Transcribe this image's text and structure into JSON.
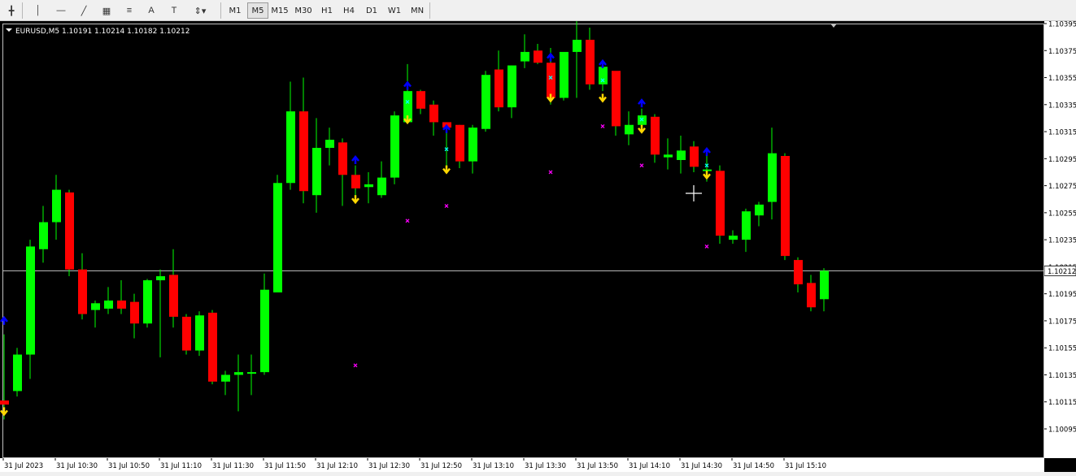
{
  "toolbar": {
    "tools": [
      {
        "name": "crosshair-icon",
        "glyph": "╋"
      },
      {
        "name": "vertical-line-icon",
        "glyph": "│"
      },
      {
        "name": "horizontal-line-icon",
        "glyph": "—"
      },
      {
        "name": "trendline-icon",
        "glyph": "╱"
      },
      {
        "name": "gann-icon",
        "glyph": "▦"
      },
      {
        "name": "fibonacci-icon",
        "glyph": "≡"
      },
      {
        "name": "text-icon",
        "glyph": "A"
      },
      {
        "name": "text-label-icon",
        "glyph": "T"
      },
      {
        "name": "arrows-menu-icon",
        "glyph": "⇕▾"
      }
    ],
    "timeframes": [
      "M1",
      "M5",
      "M15",
      "M30",
      "H1",
      "H4",
      "D1",
      "W1",
      "MN"
    ],
    "active_timeframe": "M5"
  },
  "chart": {
    "header": "EURUSD,M5  1.10191 1.10214 1.10182 1.10212",
    "current_price": "1.10212",
    "colors": {
      "bull": "#00ff00",
      "bear": "#ff0000",
      "wick": "#00ff00",
      "background": "#000000",
      "up_arrow": "#0000ff",
      "down_arrow": "#ffd700",
      "cross_cyan": "#00ffff",
      "cross_magenta": "#ff00ff"
    }
  },
  "chart_data": {
    "type": "candlestick",
    "symbol": "EURUSD",
    "timeframe": "M5",
    "y_ticks": [
      "1.10395",
      "1.10375",
      "1.10355",
      "1.10335",
      "1.10315",
      "1.10295",
      "1.10275",
      "1.10255",
      "1.10235",
      "1.10215",
      "1.10195",
      "1.10175",
      "1.10155",
      "1.10135",
      "1.10115",
      "1.10095"
    ],
    "x_ticks": [
      "31 Jul 2023",
      "31 Jul 10:30",
      "31 Jul 10:50",
      "31 Jul 11:10",
      "31 Jul 11:30",
      "31 Jul 11:50",
      "31 Jul 12:10",
      "31 Jul 12:30",
      "31 Jul 12:50",
      "31 Jul 13:10",
      "31 Jul 13:30",
      "31 Jul 13:50",
      "31 Jul 14:10",
      "31 Jul 14:30",
      "31 Jul 14:50",
      "31 Jul 15:10"
    ],
    "ylim": [
      1.10085,
      1.10415
    ],
    "candles": [
      {
        "o": 1.10116,
        "h": 1.10165,
        "l": 1.10102,
        "c": 1.10113
      },
      {
        "o": 1.10123,
        "h": 1.10155,
        "l": 1.10119,
        "c": 1.1015
      },
      {
        "o": 1.1015,
        "h": 1.10235,
        "l": 1.10132,
        "c": 1.1023
      },
      {
        "o": 1.10228,
        "h": 1.1026,
        "l": 1.10218,
        "c": 1.10248
      },
      {
        "o": 1.10248,
        "h": 1.10283,
        "l": 1.10235,
        "c": 1.10272
      },
      {
        "o": 1.1027,
        "h": 1.10272,
        "l": 1.10208,
        "c": 1.10213
      },
      {
        "o": 1.10213,
        "h": 1.10225,
        "l": 1.10176,
        "c": 1.1018
      },
      {
        "o": 1.10183,
        "h": 1.1019,
        "l": 1.1017,
        "c": 1.10188
      },
      {
        "o": 1.10184,
        "h": 1.102,
        "l": 1.1018,
        "c": 1.1019
      },
      {
        "o": 1.1019,
        "h": 1.10205,
        "l": 1.1018,
        "c": 1.10184
      },
      {
        "o": 1.10189,
        "h": 1.10195,
        "l": 1.10162,
        "c": 1.10173
      },
      {
        "o": 1.10173,
        "h": 1.10206,
        "l": 1.1017,
        "c": 1.10205
      },
      {
        "o": 1.10205,
        "h": 1.10213,
        "l": 1.10148,
        "c": 1.10208
      },
      {
        "o": 1.10209,
        "h": 1.10228,
        "l": 1.1017,
        "c": 1.10178
      },
      {
        "o": 1.10178,
        "h": 1.1018,
        "l": 1.1015,
        "c": 1.10153
      },
      {
        "o": 1.10153,
        "h": 1.10182,
        "l": 1.10149,
        "c": 1.10179
      },
      {
        "o": 1.10181,
        "h": 1.10183,
        "l": 1.10128,
        "c": 1.1013
      },
      {
        "o": 1.1013,
        "h": 1.10138,
        "l": 1.1012,
        "c": 1.10135
      },
      {
        "o": 1.10135,
        "h": 1.1015,
        "l": 1.10108,
        "c": 1.10137
      },
      {
        "o": 1.10137,
        "h": 1.1015,
        "l": 1.1012,
        "c": 1.10137
      },
      {
        "o": 1.10137,
        "h": 1.1021,
        "l": 1.10135,
        "c": 1.10198
      },
      {
        "o": 1.10196,
        "h": 1.10283,
        "l": 1.10196,
        "c": 1.10277
      },
      {
        "o": 1.10277,
        "h": 1.10352,
        "l": 1.10272,
        "c": 1.1033
      },
      {
        "o": 1.1033,
        "h": 1.10355,
        "l": 1.10262,
        "c": 1.10271
      },
      {
        "o": 1.10268,
        "h": 1.10325,
        "l": 1.10255,
        "c": 1.10303
      },
      {
        "o": 1.10303,
        "h": 1.10318,
        "l": 1.1029,
        "c": 1.10309
      },
      {
        "o": 1.10307,
        "h": 1.1031,
        "l": 1.1026,
        "c": 1.10283
      },
      {
        "o": 1.10283,
        "h": 1.1029,
        "l": 1.10262,
        "c": 1.10273
      },
      {
        "o": 1.10274,
        "h": 1.10285,
        "l": 1.10262,
        "c": 1.10276
      },
      {
        "o": 1.10268,
        "h": 1.10293,
        "l": 1.10266,
        "c": 1.10281
      },
      {
        "o": 1.10281,
        "h": 1.1033,
        "l": 1.10276,
        "c": 1.10327
      },
      {
        "o": 1.10322,
        "h": 1.10365,
        "l": 1.10322,
        "c": 1.10345
      },
      {
        "o": 1.10345,
        "h": 1.10346,
        "l": 1.10328,
        "c": 1.10332
      },
      {
        "o": 1.10335,
        "h": 1.10338,
        "l": 1.10312,
        "c": 1.10322
      },
      {
        "o": 1.10322,
        "h": 1.1032,
        "l": 1.10285,
        "c": 1.10318
      },
      {
        "o": 1.1032,
        "h": 1.1032,
        "l": 1.10288,
        "c": 1.10293
      },
      {
        "o": 1.10293,
        "h": 1.1032,
        "l": 1.10284,
        "c": 1.10318
      },
      {
        "o": 1.10317,
        "h": 1.1036,
        "l": 1.10315,
        "c": 1.10357
      },
      {
        "o": 1.10361,
        "h": 1.10375,
        "l": 1.1033,
        "c": 1.10333
      },
      {
        "o": 1.10333,
        "h": 1.10364,
        "l": 1.10325,
        "c": 1.10364
      },
      {
        "o": 1.10367,
        "h": 1.10387,
        "l": 1.10362,
        "c": 1.10374
      },
      {
        "o": 1.10375,
        "h": 1.1038,
        "l": 1.10365,
        "c": 1.10366
      },
      {
        "o": 1.10366,
        "h": 1.10377,
        "l": 1.10335,
        "c": 1.1034
      },
      {
        "o": 1.1034,
        "h": 1.10373,
        "l": 1.10338,
        "c": 1.10374
      },
      {
        "o": 1.10374,
        "h": 1.104,
        "l": 1.1034,
        "c": 1.10383
      },
      {
        "o": 1.10383,
        "h": 1.10392,
        "l": 1.10346,
        "c": 1.1035
      },
      {
        "o": 1.1035,
        "h": 1.10365,
        "l": 1.10345,
        "c": 1.10363
      },
      {
        "o": 1.1036,
        "h": 1.10355,
        "l": 1.10312,
        "c": 1.10319
      },
      {
        "o": 1.10313,
        "h": 1.1033,
        "l": 1.10305,
        "c": 1.1032
      },
      {
        "o": 1.1032,
        "h": 1.10332,
        "l": 1.10315,
        "c": 1.10327
      },
      {
        "o": 1.10326,
        "h": 1.10328,
        "l": 1.10292,
        "c": 1.10298
      },
      {
        "o": 1.10296,
        "h": 1.1031,
        "l": 1.10287,
        "c": 1.10298
      },
      {
        "o": 1.10294,
        "h": 1.10312,
        "l": 1.10284,
        "c": 1.10301
      },
      {
        "o": 1.10304,
        "h": 1.10308,
        "l": 1.10285,
        "c": 1.10289
      },
      {
        "o": 1.10286,
        "h": 1.10298,
        "l": 1.10278,
        "c": 1.10287
      },
      {
        "o": 1.10286,
        "h": 1.1029,
        "l": 1.10232,
        "c": 1.10238
      },
      {
        "o": 1.10235,
        "h": 1.10242,
        "l": 1.10232,
        "c": 1.10238
      },
      {
        "o": 1.10235,
        "h": 1.10258,
        "l": 1.10226,
        "c": 1.10256
      },
      {
        "o": 1.10253,
        "h": 1.10263,
        "l": 1.10245,
        "c": 1.10261
      },
      {
        "o": 1.10263,
        "h": 1.10318,
        "l": 1.1025,
        "c": 1.10299
      },
      {
        "o": 1.10297,
        "h": 1.10299,
        "l": 1.1022,
        "c": 1.10223
      },
      {
        "o": 1.1022,
        "h": 1.10222,
        "l": 1.10196,
        "c": 1.10202
      },
      {
        "o": 1.10203,
        "h": 1.10209,
        "l": 1.10182,
        "c": 1.10185
      },
      {
        "o": 1.10191,
        "h": 1.10214,
        "l": 1.10182,
        "c": 1.10212
      }
    ],
    "signals": [
      {
        "i": 0,
        "type": "down",
        "price": 1.10108
      },
      {
        "i": 0,
        "type": "up",
        "price": 1.10175
      },
      {
        "i": 27,
        "type": "up",
        "price": 1.10294
      },
      {
        "i": 27,
        "type": "down",
        "price": 1.10265
      },
      {
        "i": 27,
        "type": "cross_m",
        "price": 1.10142
      },
      {
        "i": 31,
        "type": "up",
        "price": 1.10349
      },
      {
        "i": 31,
        "type": "cross_c",
        "price": 1.10337
      },
      {
        "i": 31,
        "type": "down",
        "price": 1.10324
      },
      {
        "i": 31,
        "type": "cross_m",
        "price": 1.10249
      },
      {
        "i": 34,
        "type": "up",
        "price": 1.10317
      },
      {
        "i": 34,
        "type": "cross_c",
        "price": 1.10302
      },
      {
        "i": 34,
        "type": "down",
        "price": 1.10287
      },
      {
        "i": 34,
        "type": "cross_m",
        "price": 1.1026
      },
      {
        "i": 42,
        "type": "up",
        "price": 1.1037
      },
      {
        "i": 42,
        "type": "cross_c",
        "price": 1.10355
      },
      {
        "i": 42,
        "type": "down",
        "price": 1.1034
      },
      {
        "i": 42,
        "type": "cross_m",
        "price": 1.10285
      },
      {
        "i": 46,
        "type": "up",
        "price": 1.10365
      },
      {
        "i": 46,
        "type": "cross_c",
        "price": 1.10353
      },
      {
        "i": 46,
        "type": "down",
        "price": 1.1034
      },
      {
        "i": 46,
        "type": "cross_m",
        "price": 1.10319
      },
      {
        "i": 49,
        "type": "up",
        "price": 1.10336
      },
      {
        "i": 49,
        "type": "cross_c",
        "price": 1.10324
      },
      {
        "i": 49,
        "type": "down",
        "price": 1.10317
      },
      {
        "i": 49,
        "type": "cross_m",
        "price": 1.1029
      },
      {
        "i": 54,
        "type": "up",
        "price": 1.103
      },
      {
        "i": 54,
        "type": "cross_c",
        "price": 1.1029
      },
      {
        "i": 54,
        "type": "down",
        "price": 1.10283
      },
      {
        "i": 54,
        "type": "cross_m",
        "price": 1.1023
      }
    ]
  }
}
